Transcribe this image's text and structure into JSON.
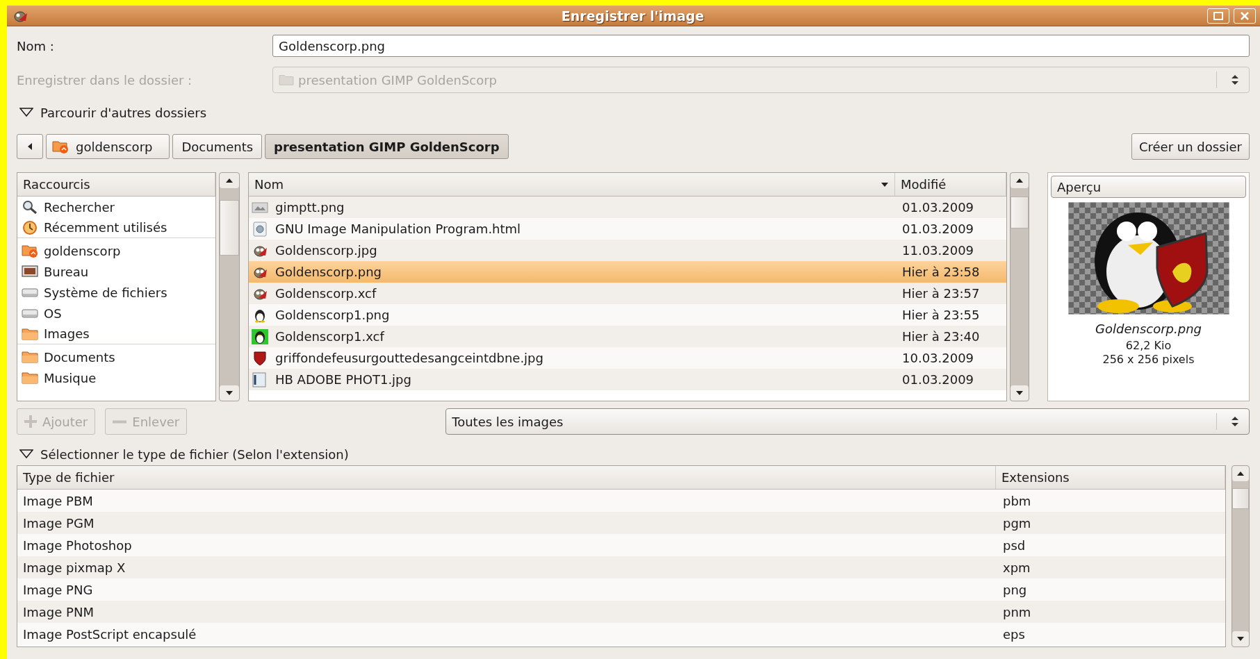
{
  "window": {
    "title": "Enregistrer l'image"
  },
  "name_field": {
    "label": "Nom :",
    "value": "Goldenscorp.png"
  },
  "save_folder": {
    "label": "Enregistrer dans le dossier :",
    "value": "presentation GIMP GoldenScorp",
    "disabled": true
  },
  "browse_expander": {
    "label": "Parcourir d'autres dossiers",
    "expanded": true
  },
  "path_bar": [
    {
      "label": "goldenscorp",
      "kind": "home",
      "selected": false
    },
    {
      "label": "Documents",
      "kind": "folder",
      "selected": false
    },
    {
      "label": "presentation GIMP GoldenScorp",
      "kind": "folder",
      "selected": true
    }
  ],
  "create_folder_button": "Créer un dossier",
  "shortcuts": {
    "header": "Raccourcis",
    "items": [
      {
        "label": "Rechercher",
        "kind": "search",
        "separator_after": false
      },
      {
        "label": "Récemment utilisés",
        "kind": "recent",
        "separator_after": true
      },
      {
        "label": "goldenscorp",
        "kind": "home",
        "separator_after": false
      },
      {
        "label": "Bureau",
        "kind": "desktop",
        "separator_after": false
      },
      {
        "label": "Système de fichiers",
        "kind": "drive",
        "separator_after": false
      },
      {
        "label": "OS",
        "kind": "drive",
        "separator_after": false
      },
      {
        "label": "Images",
        "kind": "folder",
        "separator_after": true
      },
      {
        "label": "Documents",
        "kind": "folder",
        "separator_after": false
      },
      {
        "label": "Musique",
        "kind": "folder",
        "separator_after": false
      }
    ]
  },
  "files": {
    "columns": [
      "Nom",
      "Modifié"
    ],
    "rows": [
      {
        "name": "gimptt.png",
        "modified": "01.03.2009",
        "kind": "thumb",
        "selected": false
      },
      {
        "name": "GNU Image Manipulation Program.html",
        "modified": "01.03.2009",
        "kind": "html",
        "selected": false
      },
      {
        "name": "Goldenscorp.jpg",
        "modified": "11.03.2009",
        "kind": "gimp",
        "selected": false
      },
      {
        "name": "Goldenscorp.png",
        "modified": "Hier à 23:58",
        "kind": "gimp",
        "selected": true
      },
      {
        "name": "Goldenscorp.xcf",
        "modified": "Hier à 23:57",
        "kind": "gimp",
        "selected": false
      },
      {
        "name": "Goldenscorp1.png",
        "modified": "Hier à 23:55",
        "kind": "penguin",
        "selected": false
      },
      {
        "name": "Goldenscorp1.xcf",
        "modified": "Hier à 23:40",
        "kind": "penguin-green",
        "selected": false
      },
      {
        "name": "griffondefeusurgouttedesangceintdbne.jpg",
        "modified": "10.03.2009",
        "kind": "shield",
        "selected": false
      },
      {
        "name": "HB ADOBE PHOT1.jpg",
        "modified": "01.03.2009",
        "kind": "photo",
        "selected": false
      }
    ]
  },
  "preview": {
    "header": "Aperçu",
    "file_name": "Goldenscorp.png",
    "size": "62,2 Kio",
    "dimensions": "256 x 256 pixels"
  },
  "add_button": {
    "label": "Ajouter",
    "disabled": true
  },
  "remove_button": {
    "label": "Enlever",
    "disabled": true
  },
  "filter": {
    "value": "Toutes les images"
  },
  "type_expander": {
    "label": "Sélectionner le type de fichier (Selon l'extension)",
    "expanded": true
  },
  "file_types": {
    "columns": [
      "Type de fichier",
      "Extensions"
    ],
    "rows": [
      {
        "type": "Image PBM",
        "extension": "pbm"
      },
      {
        "type": "Image PGM",
        "extension": "pgm"
      },
      {
        "type": "Image Photoshop",
        "extension": "psd"
      },
      {
        "type": "Image pixmap X",
        "extension": "xpm"
      },
      {
        "type": "Image PNG",
        "extension": "png"
      },
      {
        "type": "Image PNM",
        "extension": "pnm"
      },
      {
        "type": "Image PostScript encapsulé",
        "extension": "eps"
      }
    ]
  }
}
